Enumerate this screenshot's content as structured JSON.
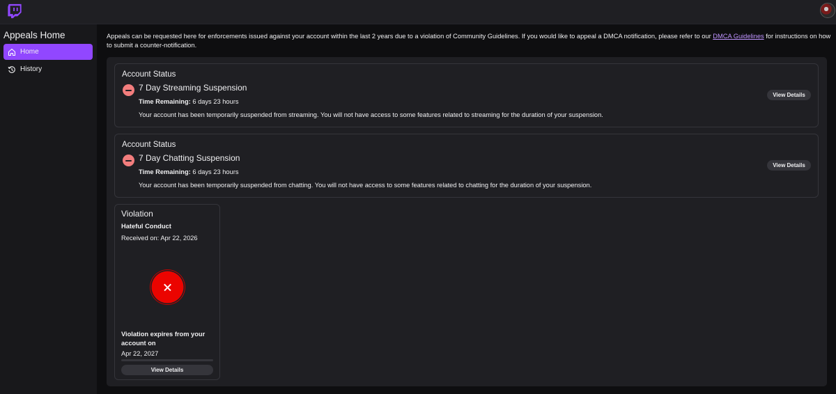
{
  "brand": {
    "logo_color": "#9147ff",
    "accent": "#9147ff"
  },
  "sidebar": {
    "title": "Appeals Home",
    "items": [
      {
        "label": "Home",
        "icon": "home-icon",
        "active": true
      },
      {
        "label": "History",
        "icon": "history-icon",
        "active": false
      }
    ]
  },
  "intro": {
    "text_before": "Appeals can be requested here for enforcements issued against your account within the last 2 years due to a violation of Community Guidelines. If you would like to appeal a DMCA notification, please refer to our ",
    "link": "DMCA Guidelines",
    "text_after": " for instructions on how to submit a counter-notification."
  },
  "status_cards": [
    {
      "heading": "Account Status",
      "title": "7 Day Streaming Suspension",
      "time_label": "Time Remaining:",
      "time_value": " 6 days 23 hours",
      "description": "Your account has been temporarily suspended from streaming. You will not have access to some features related to streaming for the duration of your suspension.",
      "button": "View Details"
    },
    {
      "heading": "Account Status",
      "title": "7 Day Chatting Suspension",
      "time_label": "Time Remaining:",
      "time_value": " 6 days 23 hours",
      "description": "Your account has been temporarily suspended from chatting. You will not have access to some features related to chatting for the duration of your suspension.",
      "button": "View Details"
    }
  ],
  "violation": {
    "title": "Violation",
    "type": "Hateful Conduct",
    "received": "Received on: Apr 22, 2026",
    "icon": "x-circle-icon",
    "expires_label": "Violation expires from your account on",
    "expires_date": "Apr 22, 2027",
    "progress": 0,
    "button": "View Details"
  }
}
